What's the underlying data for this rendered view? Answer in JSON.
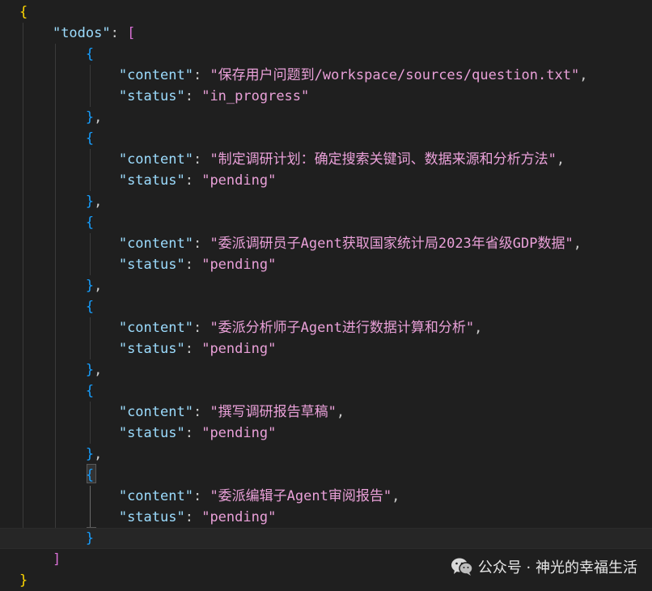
{
  "editor": {
    "lines": [
      [
        {
          "t": "{",
          "c": "tok-brace-gold"
        }
      ],
      [
        {
          "t": "    ",
          "c": ""
        },
        {
          "t": "\"todos\"",
          "c": "tok-key"
        },
        {
          "t": ": ",
          "c": "tok-punct"
        },
        {
          "t": "[",
          "c": "tok-bracket-pink"
        }
      ],
      [
        {
          "t": "        ",
          "c": ""
        },
        {
          "t": "{",
          "c": "tok-brace-blue"
        }
      ],
      [
        {
          "t": "            ",
          "c": ""
        },
        {
          "t": "\"content\"",
          "c": "tok-key"
        },
        {
          "t": ": ",
          "c": "tok-punct"
        },
        {
          "t": "\"保存用户问题到/workspace/sources/question.txt\"",
          "c": "tok-str val"
        },
        {
          "t": ",",
          "c": "tok-punct"
        }
      ],
      [
        {
          "t": "            ",
          "c": ""
        },
        {
          "t": "\"status\"",
          "c": "tok-key"
        },
        {
          "t": ": ",
          "c": "tok-punct"
        },
        {
          "t": "\"in_progress\"",
          "c": "tok-str val"
        }
      ],
      [
        {
          "t": "        ",
          "c": ""
        },
        {
          "t": "}",
          "c": "tok-brace-blue"
        },
        {
          "t": ",",
          "c": "tok-punct"
        }
      ],
      [
        {
          "t": "        ",
          "c": ""
        },
        {
          "t": "{",
          "c": "tok-brace-blue"
        }
      ],
      [
        {
          "t": "            ",
          "c": ""
        },
        {
          "t": "\"content\"",
          "c": "tok-key"
        },
        {
          "t": ": ",
          "c": "tok-punct"
        },
        {
          "t": "\"制定调研计划：确定搜索关键词、数据来源和分析方法\"",
          "c": "tok-str val"
        },
        {
          "t": ",",
          "c": "tok-punct"
        }
      ],
      [
        {
          "t": "            ",
          "c": ""
        },
        {
          "t": "\"status\"",
          "c": "tok-key"
        },
        {
          "t": ": ",
          "c": "tok-punct"
        },
        {
          "t": "\"pending\"",
          "c": "tok-str val"
        }
      ],
      [
        {
          "t": "        ",
          "c": ""
        },
        {
          "t": "}",
          "c": "tok-brace-blue"
        },
        {
          "t": ",",
          "c": "tok-punct"
        }
      ],
      [
        {
          "t": "        ",
          "c": ""
        },
        {
          "t": "{",
          "c": "tok-brace-blue"
        }
      ],
      [
        {
          "t": "            ",
          "c": ""
        },
        {
          "t": "\"content\"",
          "c": "tok-key"
        },
        {
          "t": ": ",
          "c": "tok-punct"
        },
        {
          "t": "\"委派调研员子Agent获取国家统计局2023年省级GDP数据\"",
          "c": "tok-str val"
        },
        {
          "t": ",",
          "c": "tok-punct"
        }
      ],
      [
        {
          "t": "            ",
          "c": ""
        },
        {
          "t": "\"status\"",
          "c": "tok-key"
        },
        {
          "t": ": ",
          "c": "tok-punct"
        },
        {
          "t": "\"pending\"",
          "c": "tok-str val"
        }
      ],
      [
        {
          "t": "        ",
          "c": ""
        },
        {
          "t": "}",
          "c": "tok-brace-blue"
        },
        {
          "t": ",",
          "c": "tok-punct"
        }
      ],
      [
        {
          "t": "        ",
          "c": ""
        },
        {
          "t": "{",
          "c": "tok-brace-blue"
        }
      ],
      [
        {
          "t": "            ",
          "c": ""
        },
        {
          "t": "\"content\"",
          "c": "tok-key"
        },
        {
          "t": ": ",
          "c": "tok-punct"
        },
        {
          "t": "\"委派分析师子Agent进行数据计算和分析\"",
          "c": "tok-str val"
        },
        {
          "t": ",",
          "c": "tok-punct"
        }
      ],
      [
        {
          "t": "            ",
          "c": ""
        },
        {
          "t": "\"status\"",
          "c": "tok-key"
        },
        {
          "t": ": ",
          "c": "tok-punct"
        },
        {
          "t": "\"pending\"",
          "c": "tok-str val"
        }
      ],
      [
        {
          "t": "        ",
          "c": ""
        },
        {
          "t": "}",
          "c": "tok-brace-blue"
        },
        {
          "t": ",",
          "c": "tok-punct"
        }
      ],
      [
        {
          "t": "        ",
          "c": ""
        },
        {
          "t": "{",
          "c": "tok-brace-blue"
        }
      ],
      [
        {
          "t": "            ",
          "c": ""
        },
        {
          "t": "\"content\"",
          "c": "tok-key"
        },
        {
          "t": ": ",
          "c": "tok-punct"
        },
        {
          "t": "\"撰写调研报告草稿\"",
          "c": "tok-str val"
        },
        {
          "t": ",",
          "c": "tok-punct"
        }
      ],
      [
        {
          "t": "            ",
          "c": ""
        },
        {
          "t": "\"status\"",
          "c": "tok-key"
        },
        {
          "t": ": ",
          "c": "tok-punct"
        },
        {
          "t": "\"pending\"",
          "c": "tok-str val"
        }
      ],
      [
        {
          "t": "        ",
          "c": ""
        },
        {
          "t": "}",
          "c": "tok-brace-blue"
        },
        {
          "t": ",",
          "c": "tok-punct"
        }
      ],
      [
        {
          "t": "        ",
          "c": ""
        },
        {
          "t": "{",
          "c": "tok-brace-blue"
        }
      ],
      [
        {
          "t": "            ",
          "c": ""
        },
        {
          "t": "\"content\"",
          "c": "tok-key"
        },
        {
          "t": ": ",
          "c": "tok-punct"
        },
        {
          "t": "\"委派编辑子Agent审阅报告\"",
          "c": "tok-str val"
        },
        {
          "t": ",",
          "c": "tok-punct"
        }
      ],
      [
        {
          "t": "            ",
          "c": ""
        },
        {
          "t": "\"status\"",
          "c": "tok-key"
        },
        {
          "t": ": ",
          "c": "tok-punct"
        },
        {
          "t": "\"pending\"",
          "c": "tok-str val"
        }
      ],
      [
        {
          "t": "        ",
          "c": ""
        },
        {
          "t": "}",
          "c": "tok-brace-blue"
        }
      ],
      [
        {
          "t": "    ",
          "c": ""
        },
        {
          "t": "]",
          "c": "tok-bracket-pink"
        }
      ],
      [
        {
          "t": "}",
          "c": "tok-brace-gold"
        }
      ]
    ]
  },
  "watermark": {
    "icon": "wechat-icon",
    "text": "公众号 · 神光的幸福生活"
  },
  "colors": {
    "background": "#1f1f1f",
    "key": "#9cdcfe",
    "string": "#e9a0d8",
    "brace_gold": "#ffd700",
    "bracket_pink": "#da70d6",
    "brace_blue": "#179fff"
  }
}
